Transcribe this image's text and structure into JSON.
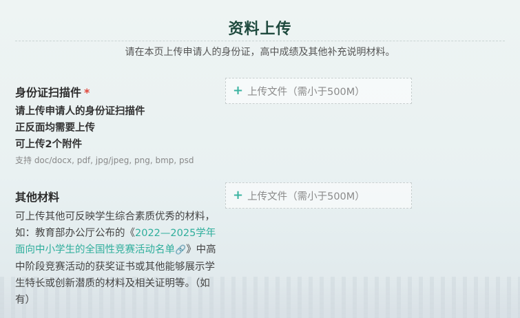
{
  "header": {
    "title": "资料上传",
    "subtitle": "请在本页上传申请人的身份证，高中成绩及其他补充说明材料。"
  },
  "sections": [
    {
      "title": "身份证扫描件",
      "required_mark": "*",
      "hints": [
        "请上传申请人的身份证扫描件",
        "正反面均需要上传",
        "可上传2个附件"
      ],
      "formats": "支持 doc/docx, pdf, jpg/jpeg, png, bmp, psd",
      "upload_label": "上传文件（需小于500M）"
    },
    {
      "title": "其他材料",
      "desc_before": "可上传其他可反映学生综合素质优秀的材料，如：教育部办公厅公布的《",
      "desc_link": "2022—2025学年面向中小学生的全国性竞赛活动名单",
      "desc_after": "》中高中阶段竞赛活动的获奖证书或其他能够展示学生特长或创新潜质的材料及相关证明等。（如有）",
      "upload_label": "上传文件（需小于500M）"
    }
  ],
  "icons": {
    "plus": "plus-icon",
    "link": "link-icon"
  },
  "colors": {
    "title": "#1f4a3e",
    "accent": "#2fae9c",
    "required": "#e0463a"
  }
}
